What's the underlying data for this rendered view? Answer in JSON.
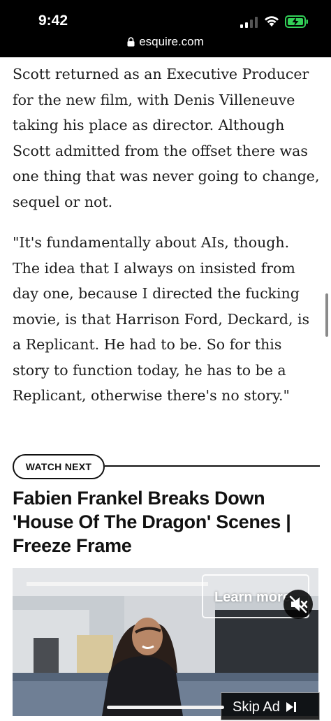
{
  "status_bar": {
    "time": "9:42",
    "url": "esquire.com",
    "icons": [
      "lock-icon",
      "signal-icon",
      "wifi-icon",
      "battery-charging-icon"
    ]
  },
  "article": {
    "paragraphs": [
      "Scott returned as an Executive Producer for the new film, with Denis Villeneuve taking his place as director. Although Scott admitted from the offset there was one thing that was never going to change, sequel or not.",
      "\"It's fundamentally about AIs, though. The idea that I always on insisted from day one, because I directed the fucking movie, is that Harrison Ford, Deckard, is a Replicant. He had to be. So for this story to function today, he has to be a Replicant, otherwise there's no story.\""
    ]
  },
  "watch_next": {
    "label": "WATCH NEXT",
    "title": "Fabien Frankel Breaks Down 'House Of The Dragon' Scenes | Freeze Frame"
  },
  "video": {
    "learn_more": "Learn more",
    "skip_ad": "Skip Ad",
    "muted": true
  },
  "colors": {
    "status_bg": "#000000",
    "text": "#1c1c1c",
    "battery": "#33d158"
  }
}
